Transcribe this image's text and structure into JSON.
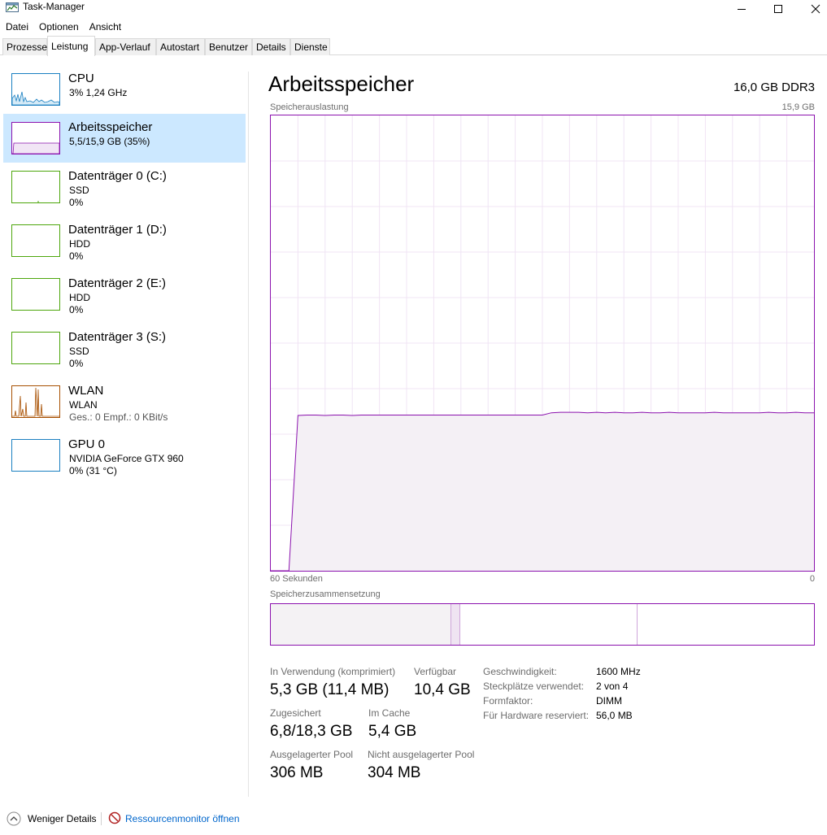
{
  "window": {
    "title": "Task-Manager",
    "minimize_icon": "minimize-icon",
    "maximize_icon": "maximize-icon",
    "close_icon": "close-icon"
  },
  "menu": [
    "Datei",
    "Optionen",
    "Ansicht"
  ],
  "tabs": [
    {
      "label": "Prozesse",
      "active": false
    },
    {
      "label": "Leistung",
      "active": true
    },
    {
      "label": "App-Verlauf",
      "active": false
    },
    {
      "label": "Autostart",
      "active": false
    },
    {
      "label": "Benutzer",
      "active": false
    },
    {
      "label": "Details",
      "active": false
    },
    {
      "label": "Dienste",
      "active": false
    }
  ],
  "sidebar": {
    "items": [
      {
        "title": "CPU",
        "line1": "3% 1,24 GHz",
        "line2": "",
        "color": "#1a7fc1",
        "selected": false
      },
      {
        "title": "Arbeitsspeicher",
        "line1": "5,5/15,9 GB (35%)",
        "line2": "",
        "color": "#8b12ae",
        "selected": true
      },
      {
        "title": "Datenträger 0 (C:)",
        "line1": "SSD",
        "line2": "0%",
        "color": "#4da60c",
        "selected": false
      },
      {
        "title": "Datenträger 1 (D:)",
        "line1": "HDD",
        "line2": "0%",
        "color": "#4da60c",
        "selected": false
      },
      {
        "title": "Datenträger 2 (E:)",
        "line1": "HDD",
        "line2": "0%",
        "color": "#4da60c",
        "selected": false
      },
      {
        "title": "Datenträger 3 (S:)",
        "line1": "SSD",
        "line2": "0%",
        "color": "#4da60c",
        "selected": false
      },
      {
        "title": "WLAN",
        "line1": "WLAN",
        "line2": "Ges.: 0 Empf.: 0 KBit/s",
        "color": "#a74f01",
        "selected": false
      },
      {
        "title": "GPU 0",
        "line1": "NVIDIA GeForce GTX 960",
        "line2": "0% (31 °C)",
        "color": "#1a7fc1",
        "selected": false
      }
    ]
  },
  "main": {
    "title": "Arbeitsspeicher",
    "spec": "16,0 GB DDR3",
    "graph_label": "Speicherauslastung",
    "graph_max": "15,9 GB",
    "time_left": "60 Sekunden",
    "time_right": "0",
    "composition_label": "Speicherzusammensetzung",
    "accent_color": "#8b12ae",
    "usage_history_fraction": [
      0.0,
      0.0,
      0.0,
      0.341,
      0.342,
      0.342,
      0.341,
      0.342,
      0.342,
      0.341,
      0.342,
      0.342,
      0.342,
      0.342,
      0.342,
      0.342,
      0.342,
      0.342,
      0.342,
      0.342,
      0.342,
      0.342,
      0.342,
      0.342,
      0.342,
      0.342,
      0.342,
      0.342,
      0.342,
      0.342,
      0.342,
      0.347,
      0.348,
      0.348,
      0.348,
      0.347,
      0.348,
      0.347,
      0.348,
      0.347,
      0.347,
      0.348,
      0.347,
      0.347,
      0.348,
      0.347,
      0.347,
      0.347,
      0.347,
      0.348,
      0.347,
      0.347,
      0.347,
      0.347,
      0.347,
      0.348,
      0.347,
      0.347,
      0.348,
      0.347,
      0.347
    ]
  },
  "stats": {
    "in_use_label": "In Verwendung (komprimiert)",
    "in_use_value": "5,3 GB (11,4 MB)",
    "available_label": "Verfügbar",
    "available_value": "10,4 GB",
    "committed_label": "Zugesichert",
    "committed_value": "6,8/18,3 GB",
    "cached_label": "Im Cache",
    "cached_value": "5,4 GB",
    "paged_label": "Ausgelagerter Pool",
    "paged_value": "306 MB",
    "nonpaged_label": "Nicht ausgelagerter Pool",
    "nonpaged_value": "304 MB"
  },
  "specs": {
    "speed_label": "Geschwindigkeit:",
    "speed_value": "1600 MHz",
    "slots_label": "Steckplätze verwendet:",
    "slots_value": "2 von 4",
    "form_label": "Formfaktor:",
    "form_value": "DIMM",
    "reserved_label": "Für Hardware reserviert:",
    "reserved_value": "56,0 MB"
  },
  "footer": {
    "fewer_details": "Weniger Details",
    "open_resmon": "Ressourcenmonitor öffnen"
  }
}
